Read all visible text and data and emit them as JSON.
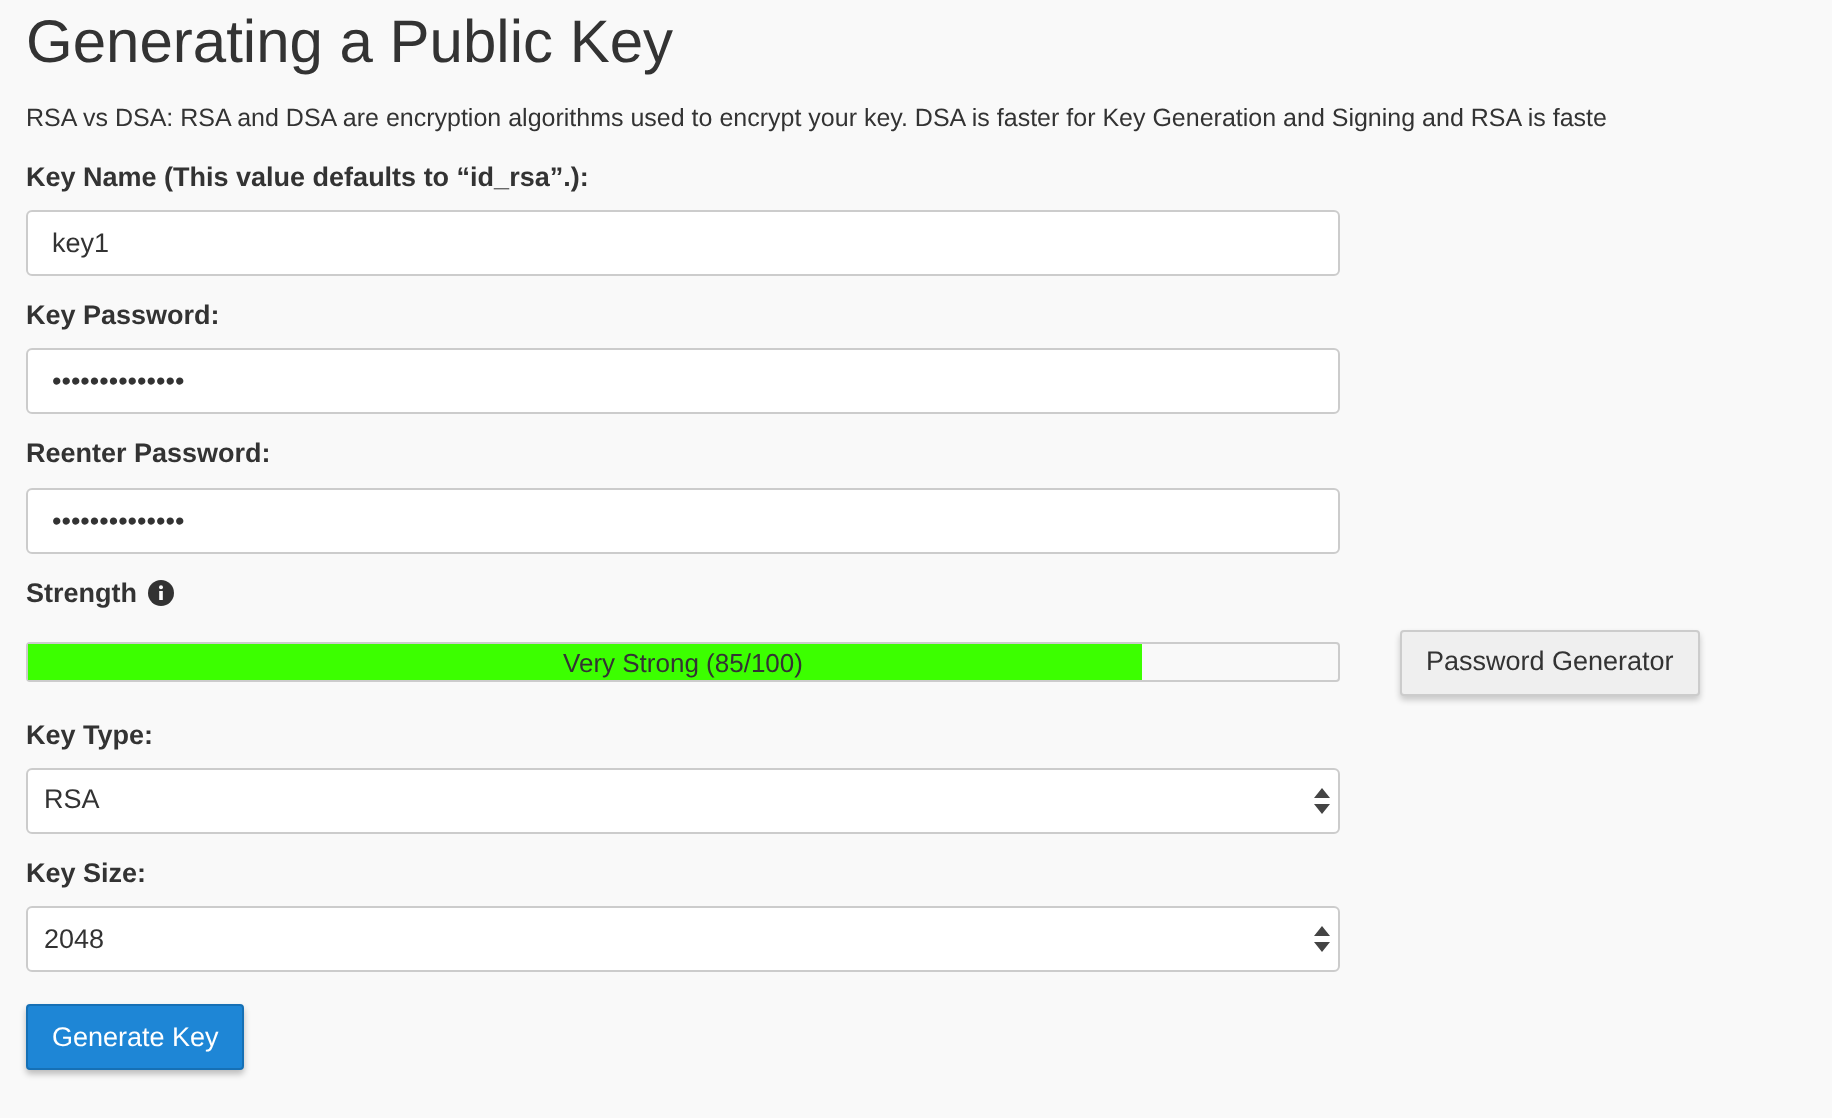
{
  "title": "Generating a Public Key",
  "description": "RSA vs DSA: RSA and DSA are encryption algorithms used to encrypt your key. DSA is faster for Key Generation and Signing and RSA is faste",
  "fields": [
    {
      "kind": "text",
      "label": "Key Name (This value defaults to “id_rsa”.):",
      "value": "key1"
    },
    {
      "kind": "text",
      "label": "Key Password:",
      "value": "••••••••••••••"
    },
    {
      "kind": "text",
      "label": "Reenter Password:",
      "value": "••••••••••••••"
    },
    {
      "kind": "strength",
      "label": "Strength",
      "level": 0.85,
      "reading": "Very Strong (85/100)",
      "button": "Password Generator"
    },
    {
      "kind": "select",
      "label": "Key Type:",
      "value": "RSA"
    },
    {
      "kind": "select",
      "label": "Key Size:",
      "value": "2048"
    }
  ],
  "submit": "Generate Key"
}
